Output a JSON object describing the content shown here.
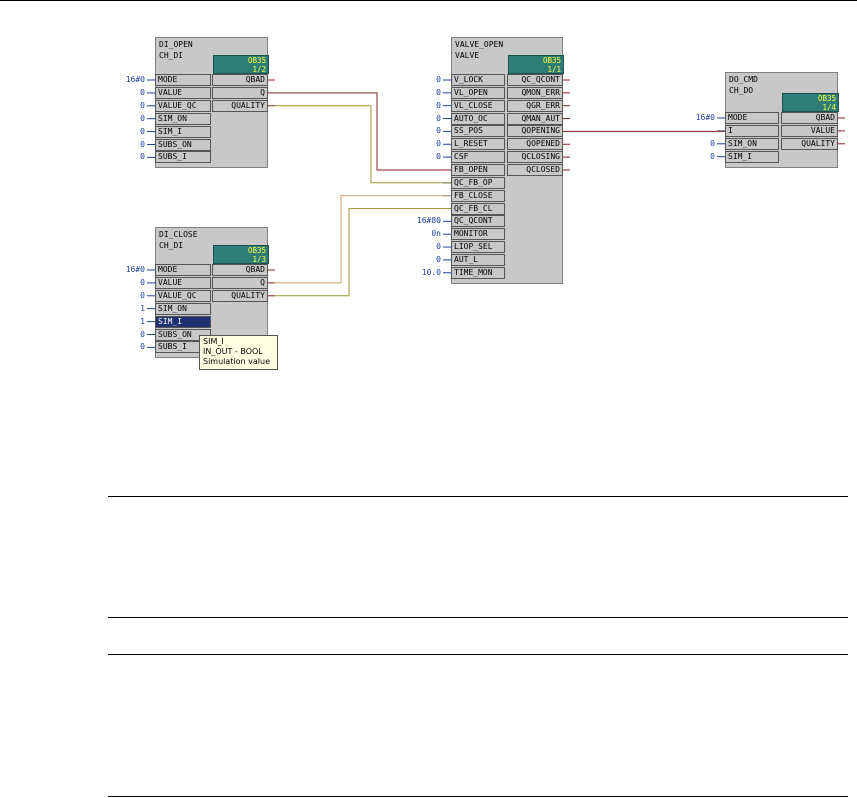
{
  "blocks": {
    "di_open": {
      "instance": "DI_OPEN",
      "type": "CH_DI",
      "ob": "OB35",
      "seq": "1/2",
      "inputs": [
        {
          "name": "MODE",
          "value": "16#0"
        },
        {
          "name": "VALUE",
          "value": "0"
        },
        {
          "name": "VALUE_QC",
          "value": "0"
        },
        {
          "name": "SIM_ON",
          "value": "0"
        },
        {
          "name": "SIM_I",
          "value": "0"
        },
        {
          "name": "SUBS_ON",
          "value": "0"
        },
        {
          "name": "SUBS_I",
          "value": "0"
        }
      ],
      "outputs": [
        "QBAD",
        "Q",
        "QUALITY"
      ]
    },
    "di_close": {
      "instance": "DI_CLOSE",
      "type": "CH_DI",
      "ob": "OB35",
      "seq": "1/3",
      "inputs": [
        {
          "name": "MODE",
          "value": "16#0"
        },
        {
          "name": "VALUE",
          "value": "0"
        },
        {
          "name": "VALUE_QC",
          "value": "0"
        },
        {
          "name": "SIM_ON",
          "value": "1"
        },
        {
          "name": "SIM_I",
          "value": "1"
        },
        {
          "name": "SUBS_ON",
          "value": "0"
        },
        {
          "name": "SUBS_I",
          "value": "0"
        }
      ],
      "outputs": [
        "QBAD",
        "Q",
        "QUALITY"
      ]
    },
    "valve_open": {
      "instance": "VALVE_OPEN",
      "type": "VALVE",
      "ob": "OB35",
      "seq": "1/1",
      "inputs": [
        {
          "name": "V_LOCK",
          "value": "0"
        },
        {
          "name": "VL_OPEN",
          "value": "0"
        },
        {
          "name": "VL_CLOSE",
          "value": "0"
        },
        {
          "name": "AUTO_OC",
          "value": "0"
        },
        {
          "name": "SS_POS",
          "value": "0"
        },
        {
          "name": "L_RESET",
          "value": "0"
        },
        {
          "name": "CSF",
          "value": "0"
        },
        {
          "name": "FB_OPEN",
          "value": ""
        },
        {
          "name": "QC_FB_OP",
          "value": ""
        },
        {
          "name": "FB_CLOSE",
          "value": ""
        },
        {
          "name": "QC_FB_CL",
          "value": ""
        },
        {
          "name": "QC_QCONT",
          "value": "16#80"
        },
        {
          "name": "MONITOR",
          "value": "0n"
        },
        {
          "name": "LIOP_SEL",
          "value": "0"
        },
        {
          "name": "AUT_L",
          "value": "0"
        },
        {
          "name": "TIME_MON",
          "value": "10.0"
        }
      ],
      "outputs": [
        "QC_QCONT",
        "QMON_ERR",
        "QGR_ERR",
        "QMAN_AUT",
        "QOPENING",
        "QOPENED",
        "QCLOSING",
        "QCLOSED"
      ]
    },
    "do_cmd": {
      "instance": "DO_CMD",
      "type": "CH_DO",
      "ob": "OB35",
      "seq": "1/4",
      "inputs": [
        {
          "name": "MODE",
          "value": "16#0"
        },
        {
          "name": "I",
          "value": ""
        },
        {
          "name": "SIM_ON",
          "value": "0"
        },
        {
          "name": "SIM_I",
          "value": "0"
        }
      ],
      "outputs": [
        "QBAD",
        "VALUE",
        "QUALITY"
      ]
    }
  },
  "tooltip": {
    "lines": [
      "SIM_I",
      "IN_OUT - BOOL",
      "Simulation value"
    ]
  },
  "colors": {
    "wire_red": "#8b2020",
    "wire_olive": "#9a9a30",
    "pin_value": "#1f3f9f",
    "ob_bg": "#2e7d76",
    "ob_text": "#ffff40"
  }
}
